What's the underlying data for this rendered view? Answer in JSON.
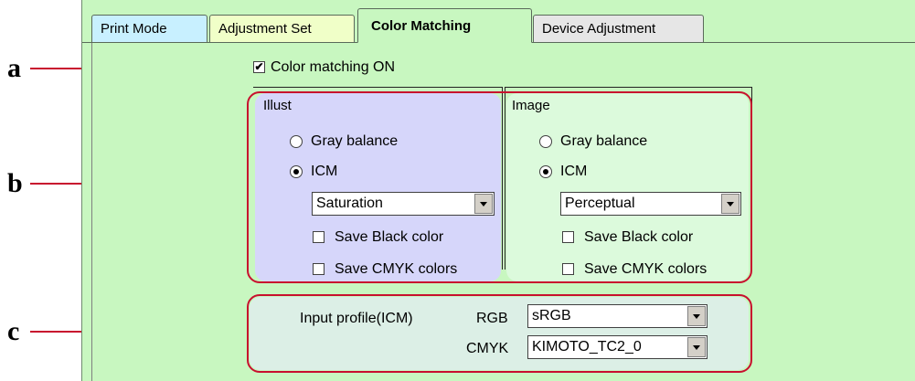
{
  "callouts": [
    "a",
    "b",
    "c"
  ],
  "tabs": [
    "Print Mode",
    "Adjustment Set",
    "Color Matching",
    "Device Adjustment"
  ],
  "color_matching": {
    "label": "Color matching ON",
    "checked": true
  },
  "illust": {
    "title": "Illust",
    "radio_gray": "Gray balance",
    "radio_icm": "ICM",
    "icm_selected": true,
    "intent": "Saturation",
    "save_black": "Save Black color",
    "save_cmyk": "Save CMYK colors"
  },
  "image": {
    "title": "Image",
    "radio_gray": "Gray balance",
    "radio_icm": "ICM",
    "icm_selected": true,
    "intent": "Perceptual",
    "save_black": "Save Black color",
    "save_cmyk": "Save CMYK colors"
  },
  "input_profile": {
    "label": "Input profile(ICM)",
    "rgb_label": "RGB",
    "rgb_value": "sRGB",
    "cmyk_label": "CMYK",
    "cmyk_value": "KIMOTO_TC2_0"
  },
  "colors": {
    "dialog_bg": "#c8f7c0",
    "illust_bg": "#d6d6fa",
    "image_bg": "#dcfadc",
    "profile_bg": "#dcefe6",
    "callout_red": "#c8102e"
  }
}
